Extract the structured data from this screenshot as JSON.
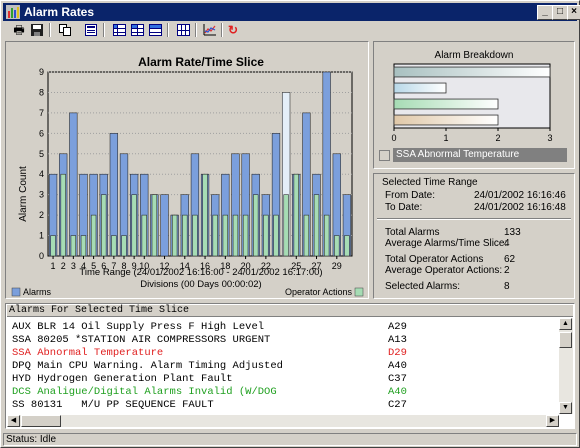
{
  "window": {
    "title": "Alarm Rates"
  },
  "toolbar": {
    "icons": [
      "print-icon",
      "save-icon",
      "copy-icon",
      "table-icon",
      "grid-icon-1",
      "grid-icon-2",
      "grid-icon-3",
      "grid-icon-4",
      "chart-icon",
      "refresh-icon"
    ]
  },
  "chart": {
    "title": "Alarm Rate/Time Slice",
    "ylabel": "Alarm Count",
    "xlabel_line1": "Time Range (24/01/2002 16:16:00 - 24/01/2002 16:17:00)",
    "xlabel_line2": "Divisions (00 Days 00:00:02)",
    "legend_alarms": "Alarms",
    "legend_operator": "Operator Actions"
  },
  "chart_data": {
    "type": "bar",
    "title": "Alarm Rate/Time Slice",
    "xlabel": "Time Range (24/01/2002 16:16:00 - 24/01/2002 16:17:00)",
    "ylabel": "Alarm Count",
    "ylim": [
      0,
      9
    ],
    "yticks": [
      0,
      1,
      2,
      3,
      4,
      5,
      6,
      7,
      8,
      9
    ],
    "xticks": [
      "1",
      "2",
      "3",
      "4",
      "5",
      "6",
      "7",
      "8",
      "9",
      "10",
      "12",
      "14",
      "16",
      "18",
      "20",
      "22",
      "25",
      "27",
      "29"
    ],
    "categories": [
      1,
      2,
      3,
      4,
      5,
      6,
      7,
      8,
      9,
      10,
      11,
      12,
      13,
      14,
      15,
      16,
      17,
      18,
      19,
      20,
      21,
      22,
      23,
      24,
      25,
      26,
      27,
      28,
      29,
      30
    ],
    "series": [
      {
        "name": "Alarms",
        "color": "#7b9fdc",
        "values": [
          4,
          5,
          7,
          4,
          4,
          4,
          6,
          5,
          4,
          4,
          3,
          3,
          2,
          3,
          5,
          4,
          3,
          4,
          5,
          5,
          4,
          3,
          6,
          8,
          4,
          7,
          4,
          9,
          5,
          3
        ]
      },
      {
        "name": "Operator Actions",
        "color": "#a6dcb4",
        "values": [
          1,
          4,
          1,
          1,
          2,
          3,
          1,
          1,
          3,
          2,
          3,
          0,
          2,
          2,
          2,
          4,
          2,
          2,
          2,
          2,
          3,
          2,
          2,
          3,
          4,
          2,
          3,
          2,
          1,
          1
        ]
      }
    ],
    "highlighted_index": 23,
    "grid": true,
    "legend": "bottom"
  },
  "breakdown": {
    "title": "Alarm Breakdown",
    "xticks": [
      "0",
      "1",
      "2",
      "3"
    ],
    "xlim": [
      0,
      3
    ],
    "bars": [
      {
        "value": 3,
        "color": "#a8c0c0"
      },
      {
        "value": 1,
        "color": "#b8d8e8"
      },
      {
        "value": 2,
        "color": "#a6dcb4"
      },
      {
        "value": 2,
        "color": "#e0c8a8"
      }
    ],
    "selected_label": "SSA Abnormal Temperature"
  },
  "time_range": {
    "group_label": "Selected Time Range",
    "from_label": "From Date:",
    "from_value": "24/01/2002 16:16:46",
    "to_label": "To Date:",
    "to_value": "24/01/2002 16:16:48"
  },
  "stats": {
    "total_alarms_label": "Total Alarms",
    "total_alarms_value": "133",
    "avg_alarms_label": "Average Alarms/Time Slice:",
    "avg_alarms_value": "4",
    "total_ops_label": "Total Operator Actions",
    "total_ops_value": "62",
    "avg_ops_label": "Average Operator Actions:",
    "avg_ops_value": "2",
    "selected_label": "Selected Alarms:",
    "selected_value": "8"
  },
  "alarm_list": {
    "header": "Alarms For Selected Time Slice",
    "rows": [
      {
        "text": "AUX BLR 14 Oil Supply Press F High Level",
        "code": "A29",
        "color": "#000000"
      },
      {
        "text": "SSA 80205 *STATION AIR COMPRESSORS URGENT",
        "code": "A13",
        "color": "#000000"
      },
      {
        "text": "SSA Abnormal Temperature",
        "code": "D29",
        "color": "#e02020"
      },
      {
        "text": "DPQ Main CPU Warning. Alarm Timing Adjusted",
        "code": "A40",
        "color": "#000000"
      },
      {
        "text": "HYD Hydrogen Generation Plant Fault",
        "code": "C37",
        "color": "#000000"
      },
      {
        "text": "DCS Analigue/Digital Alarms Invalid (W/DOG",
        "code": "A40",
        "color": "#20a020"
      },
      {
        "text": "SS 80131   M/U PP SEQUENCE FAULT",
        "code": "C27",
        "color": "#000000"
      }
    ]
  },
  "status": {
    "text": "Status: Idle"
  }
}
